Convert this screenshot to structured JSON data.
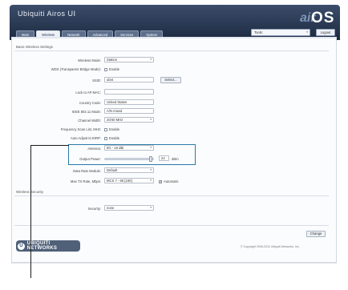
{
  "header": {
    "brand": "Ubiquiti Airos UI",
    "logo_air": "air",
    "logo_os": "OS"
  },
  "tabs": [
    {
      "label": "Main",
      "active": false
    },
    {
      "label": "Wireless",
      "active": true
    },
    {
      "label": "Network",
      "active": false
    },
    {
      "label": "Advanced",
      "active": false
    },
    {
      "label": "Services",
      "active": false
    },
    {
      "label": "System",
      "active": false
    }
  ],
  "toolbar": {
    "tools_value": "Tools:",
    "logout_label": "Logout"
  },
  "basic": {
    "title": "Basic Wireless Settings",
    "wireless_mode_label": "Wireless Mode:",
    "wireless_mode_value": "Station",
    "wds_label": "WDS (Transparent Bridge Mode):",
    "wds_check": "Enable",
    "ssid_label": "SSID:",
    "ssid_value": "ubnt",
    "select_button": "Select...",
    "lock_ap_label": "Lock to AP MAC:",
    "country_label": "Country Code:",
    "country_value": "United States",
    "ieee_label": "IEEE 802.11 Mode:",
    "ieee_value": "A/N mixed",
    "channel_width_label": "Channel Width:",
    "channel_width_value": "20/40 MHz",
    "channel_width_arr": "▾",
    "freq_list_label": "Frequency Scan List, MHz:",
    "freq_list_check": "Enable",
    "auto_adjust_label": "Auto Adjust to EIRP:",
    "auto_adjust_check": "Enable",
    "antenna_label": "Antenna:",
    "antenna_value": "5G - 16 dBi",
    "output_power_label": "Output Power:",
    "output_power_value": "24",
    "output_power_unit": "dBm",
    "data_rate_label": "Data Rate Module:",
    "data_rate_value": "Default",
    "max_tx_label": "Max TX Rate, Mbps:",
    "max_tx_value": "MCS 7 - 65 [150]",
    "automatic_check": "Automatic"
  },
  "security": {
    "title": "Wireless Security",
    "security_label": "Security:",
    "security_value": "none"
  },
  "footer": {
    "change_button": "Change",
    "ubnt_letter": "U",
    "ubnt_text": "UBIQUITI NETWORKS",
    "copyright": "© Copyright 2006-2011 Ubiquiti Networks, Inc."
  }
}
